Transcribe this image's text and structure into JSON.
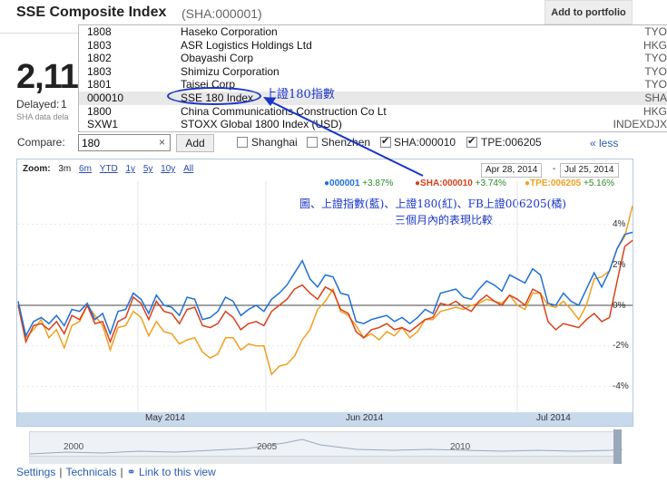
{
  "header": {
    "title": "SSE Composite Index",
    "ticker": "(SHA:000001)",
    "add_portfolio": "Add to portfolio",
    "big_price": "2,11",
    "delayed": "Delayed:",
    "delayed_value": "1",
    "disclaimer": "SHA data dela"
  },
  "dropdown": {
    "items": [
      {
        "code": "1808",
        "name": "Haseko Corporation",
        "exchange": "TYO"
      },
      {
        "code": "1803",
        "name": "ASR Logistics Holdings Ltd",
        "exchange": "HKG"
      },
      {
        "code": "1802",
        "name": "Obayashi Corp",
        "exchange": "TYO"
      },
      {
        "code": "1803",
        "name": "Shimizu Corporation",
        "exchange": "TYO"
      },
      {
        "code": "1801",
        "name": "Taisei Corp",
        "exchange": "TYO"
      },
      {
        "code": "000010",
        "name": "SSE 180 Index",
        "exchange": "SHA"
      },
      {
        "code": "1800",
        "name": "China Communications Construction Co Lt",
        "exchange": "HKG"
      },
      {
        "code": "SXW1",
        "name": "STOXX Global 1800 Index (USD)",
        "exchange": "INDEXDJX"
      }
    ]
  },
  "annotation": {
    "label": "上證180指數",
    "note_line1": "圖、上證指數(藍)、上證180(紅)、FB上證006205(橘)",
    "note_line2": "三個月內的表現比較"
  },
  "compare": {
    "label": "Compare:",
    "input_value": "180",
    "clear": "×",
    "add": "Add",
    "options": [
      {
        "label": "Shanghai",
        "checked": false
      },
      {
        "label": "Shenzhen",
        "checked": false
      },
      {
        "label": "SHA:000010",
        "checked": true
      },
      {
        "label": "TPE:006205",
        "checked": true
      }
    ],
    "less": "« less"
  },
  "chart": {
    "zoom_label": "Zoom:",
    "zoom_options": [
      "3m",
      "6m",
      "YTD",
      "1y",
      "5y",
      "10y",
      "All"
    ],
    "date_from": "Apr 28, 2014",
    "date_sep": "-",
    "date_to": "Jul 25, 2014",
    "legend": [
      {
        "name": "000001",
        "pct": "+3.87%",
        "color": "#1f6fd6"
      },
      {
        "name": "SHA:000010",
        "pct": "+3.74%",
        "color": "#d9401a"
      },
      {
        "name": "TPE:006205",
        "pct": "+5.16%",
        "color": "#f0a020"
      }
    ],
    "y_ticks": [
      "4%",
      "2%",
      "0%",
      "-2%",
      "-4%"
    ],
    "x_ticks": [
      "May 2014",
      "Jun 2014",
      "Jul 2014"
    ],
    "overview_ticks": [
      "2000",
      "2005",
      "2010"
    ]
  },
  "chart_data": {
    "type": "line",
    "title": "",
    "ylabel": "",
    "xlabel": "",
    "ylim": [
      -5,
      5
    ],
    "x_range": [
      "2014-04-28",
      "2014-07-25"
    ],
    "series": [
      {
        "name": "000001",
        "color": "#1f6fd6",
        "values": [
          0.2,
          -1.5,
          -0.8,
          -0.6,
          -0.9,
          -0.5,
          -1.0,
          -0.2,
          -0.3,
          0.1,
          -0.7,
          -0.4,
          -1.4,
          -0.3,
          -0.2,
          0.6,
          0.3,
          -0.4,
          0.5,
          0.0,
          -0.1,
          -0.5,
          0.4,
          0.3,
          -0.7,
          -0.6,
          -0.3,
          0.4,
          0.2,
          -0.5,
          -0.2,
          0.0,
          -0.3,
          0.3,
          0.6,
          1.0,
          1.6,
          2.2,
          1.3,
          0.9,
          1.5,
          1.4,
          0.6,
          0.5,
          -0.8,
          -0.9,
          -0.7,
          -0.6,
          -0.5,
          -0.8,
          -0.6,
          -0.9,
          -0.6,
          -0.2,
          -0.4,
          0.6,
          0.7,
          0.8,
          0.4,
          0.3,
          0.8,
          1.2,
          1.0,
          0.7,
          1.5,
          1.3,
          1.1,
          1.8,
          1.5,
          0.1,
          0.0,
          0.6,
          0.2,
          0.0,
          0.8,
          1.6,
          0.9,
          1.7,
          2.8,
          3.5,
          3.6
        ]
      },
      {
        "name": "SHA:000010",
        "color": "#d9401a",
        "values": [
          0.0,
          -1.8,
          -1.0,
          -0.9,
          -1.2,
          -0.8,
          -1.4,
          -0.5,
          -0.7,
          0.0,
          -0.9,
          -0.8,
          -1.8,
          -0.8,
          -0.6,
          0.4,
          0.1,
          -0.7,
          0.2,
          -0.3,
          -0.4,
          -0.9,
          -0.2,
          -0.1,
          -1.0,
          -1.1,
          -0.9,
          -0.3,
          -0.6,
          -1.2,
          -0.9,
          -0.8,
          -1.0,
          -0.3,
          0.0,
          0.3,
          0.8,
          1.0,
          0.6,
          0.3,
          0.9,
          0.7,
          -0.2,
          -0.4,
          -1.3,
          -1.6,
          -1.2,
          -1.1,
          -0.9,
          -1.2,
          -1.1,
          -1.3,
          -1.0,
          -0.7,
          -0.6,
          0.1,
          0.0,
          0.2,
          -0.1,
          -0.3,
          0.2,
          0.5,
          0.2,
          0.0,
          0.5,
          0.3,
          0.0,
          0.8,
          0.6,
          -0.8,
          -1.2,
          -0.9,
          -1.0,
          -1.1,
          -0.7,
          -0.4,
          -0.8,
          -0.6,
          1.2,
          2.9,
          3.2
        ]
      },
      {
        "name": "TPE:006205",
        "color": "#f0a020",
        "values": [
          0.1,
          -1.6,
          -1.2,
          -0.7,
          -1.6,
          -1.2,
          -2.1,
          -1.0,
          -0.8,
          0.0,
          -0.5,
          -1.0,
          -2.2,
          -1.1,
          -1.0,
          -0.3,
          -0.6,
          -1.5,
          -0.8,
          -1.3,
          -1.4,
          -1.9,
          -1.7,
          -1.6,
          -2.3,
          -2.6,
          -2.4,
          -1.6,
          -1.6,
          -2.2,
          -1.9,
          -2.0,
          -2.0,
          -3.4,
          -3.0,
          -2.9,
          -2.5,
          -1.7,
          -1.2,
          -0.2,
          0.2,
          0.8,
          -0.3,
          -0.5,
          -1.0,
          -1.6,
          -1.4,
          -1.7,
          -1.3,
          -1.5,
          -1.1,
          -1.6,
          -1.3,
          -0.7,
          -0.7,
          -0.3,
          -0.2,
          -0.1,
          -0.2,
          0.0,
          0.1,
          0.3,
          0.2,
          0.1,
          0.5,
          0.0,
          -0.2,
          0.6,
          0.6,
          0.0,
          -0.1,
          0.2,
          -0.2,
          -0.7,
          0.0,
          1.3,
          1.4,
          1.7,
          2.8,
          3.4,
          4.9
        ]
      }
    ]
  }
}
